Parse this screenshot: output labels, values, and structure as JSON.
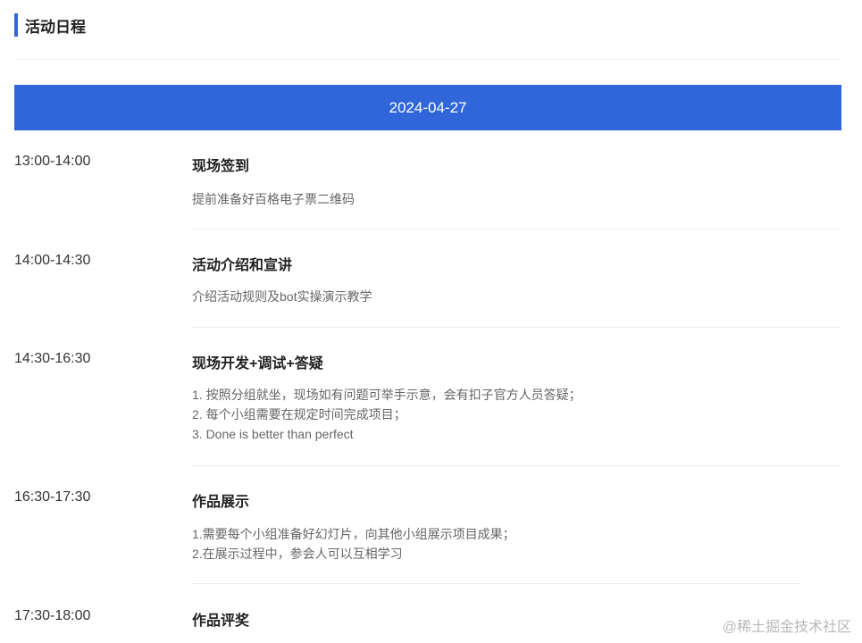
{
  "section": {
    "title": "活动日程"
  },
  "date_banner": "2024-04-27",
  "schedule": [
    {
      "time": "13:00-14:00",
      "title": "现场签到",
      "description": [
        "提前准备好百格电子票二维码"
      ]
    },
    {
      "time": "14:00-14:30",
      "title": "活动介绍和宣讲",
      "description": [
        "介绍活动规则及bot实操演示教学"
      ]
    },
    {
      "time": "14:30-16:30",
      "title": "现场开发+调试+答疑",
      "description": [
        "1. 按照分组就坐，现场如有问题可举手示意，会有扣子官方人员答疑；",
        "2. 每个小组需要在规定时间完成项目；",
        "3. Done is better than perfect"
      ]
    },
    {
      "time": "16:30-17:30",
      "title": "作品展示",
      "description": [
        "1.需要每个小组准备好幻灯片，向其他小组展示项目成果；",
        "2.在展示过程中，参会人可以互相学习"
      ]
    },
    {
      "time": "17:30-18:00",
      "title": "作品评奖",
      "description": []
    }
  ],
  "watermark": "@稀土掘金技术社区",
  "colors": {
    "accent": "#3166db",
    "title_text": "#222222",
    "body_text": "#666666",
    "divider": "#eeeeee"
  }
}
